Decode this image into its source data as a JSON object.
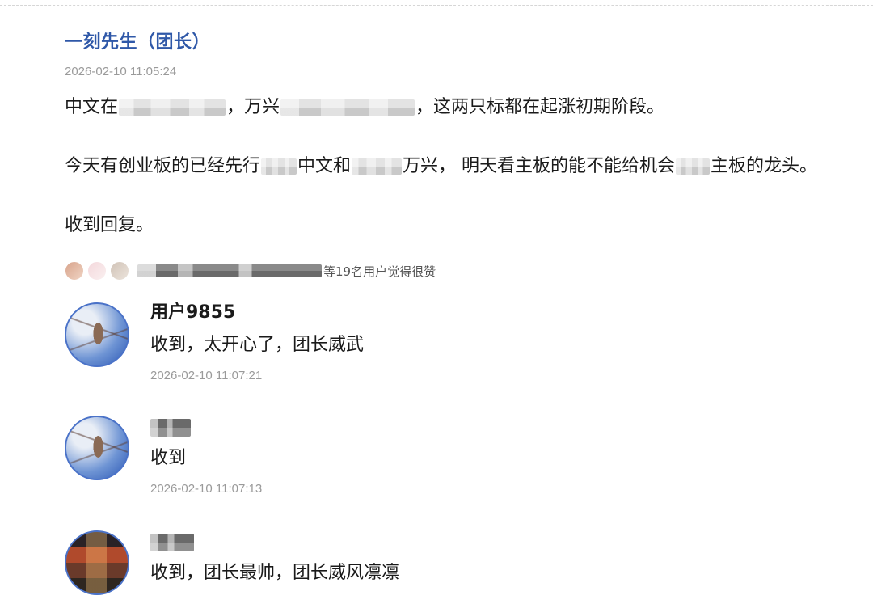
{
  "post": {
    "author": "一刻先生（团长）",
    "time": "2026-02-10 11:05:24",
    "para1": {
      "part_a": "中文在",
      "part_b": "，万兴",
      "part_c": "，这两只标都在起涨初期阶段。"
    },
    "para2": {
      "part_a": "今天有创业板的已经先行",
      "part_b": "中文和",
      "part_c": "万兴，  明天看主板的能不能给机会",
      "part_d": "主板的龙头。"
    },
    "para3": "收到回复。"
  },
  "likes": {
    "text": "等19名用户觉得很赞"
  },
  "comments": [
    {
      "user": "用户9855",
      "text": "收到，太开心了，团长威武",
      "time": "2026-02-10 11:07:21"
    },
    {
      "user": "",
      "text": "收到",
      "time": "2026-02-10 11:07:13"
    },
    {
      "user": "",
      "text": "收到，团长最帅，团长威风凛凛",
      "time": ""
    }
  ]
}
